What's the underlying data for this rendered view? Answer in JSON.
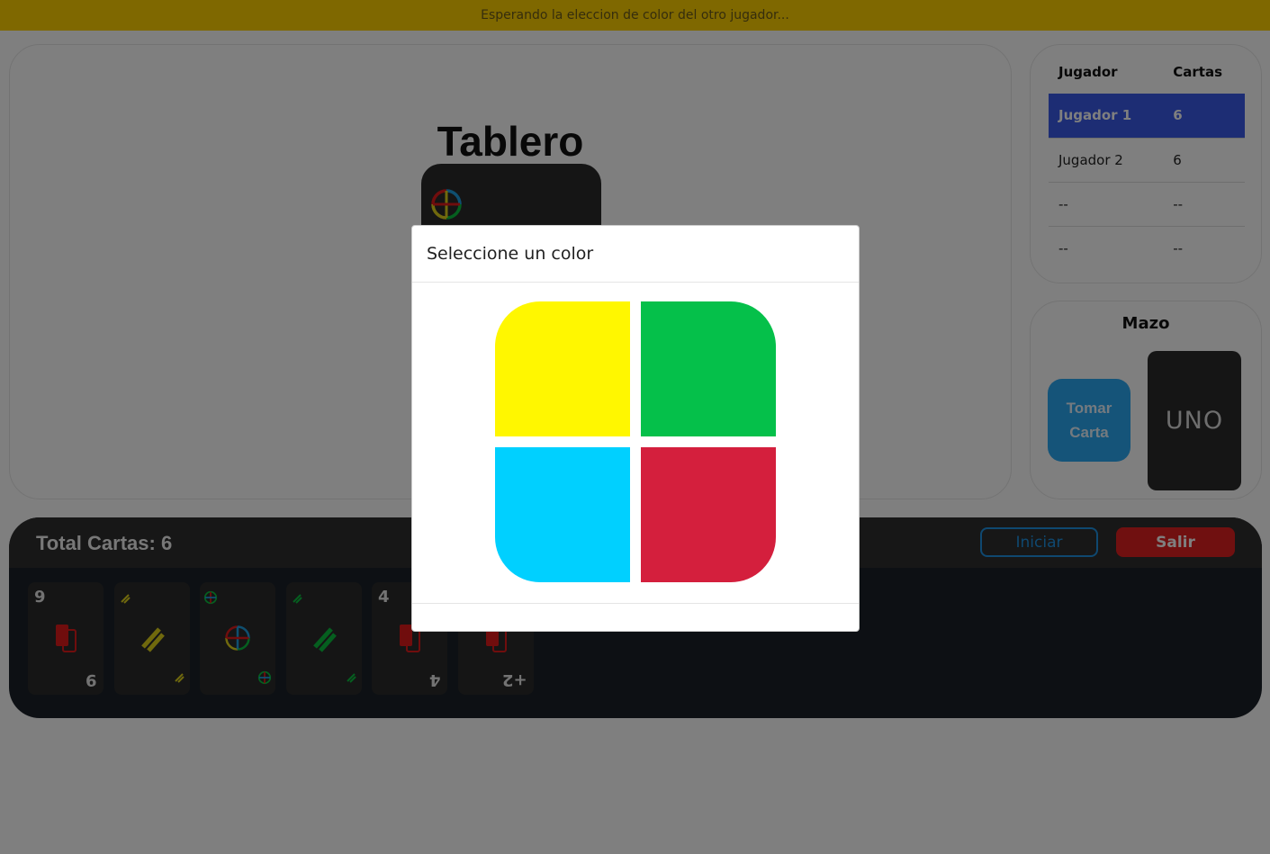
{
  "banner": {
    "text": "Esperando la eleccion de color del otro jugador..."
  },
  "board": {
    "title": "Tablero"
  },
  "players": {
    "headers": {
      "player": "Jugador",
      "cards": "Cartas"
    },
    "rows": [
      {
        "player": "Jugador 1",
        "cards": "6",
        "active": true
      },
      {
        "player": "Jugador 2",
        "cards": "6",
        "active": false
      },
      {
        "player": "--",
        "cards": "--",
        "active": false
      },
      {
        "player": "--",
        "cards": "--",
        "active": false
      }
    ]
  },
  "deck": {
    "title": "Mazo",
    "take_label": "Tomar Carta",
    "logo": "UNO"
  },
  "hand": {
    "total_label": "Total Cartas: 6",
    "start_label": "Iniciar",
    "exit_label": "Salir",
    "cards": [
      {
        "value": "9",
        "type": "number",
        "color": "#e01b1b"
      },
      {
        "value": "",
        "type": "skip",
        "color": "#e0d21b"
      },
      {
        "value": "",
        "type": "wild",
        "color": "#ffffff"
      },
      {
        "value": "",
        "type": "skip",
        "color": "#0bbf3f"
      },
      {
        "value": "4",
        "type": "number",
        "color": "#e01b1b"
      },
      {
        "value": "+2",
        "type": "draw2",
        "color": "#e01b1b"
      }
    ]
  },
  "modal": {
    "title": "Seleccione un color",
    "colors": [
      {
        "name": "yellow",
        "hex": "#fff700"
      },
      {
        "name": "green",
        "hex": "#05c04a"
      },
      {
        "name": "blue",
        "hex": "#00d0ff"
      },
      {
        "name": "red",
        "hex": "#d41f3d"
      }
    ]
  }
}
